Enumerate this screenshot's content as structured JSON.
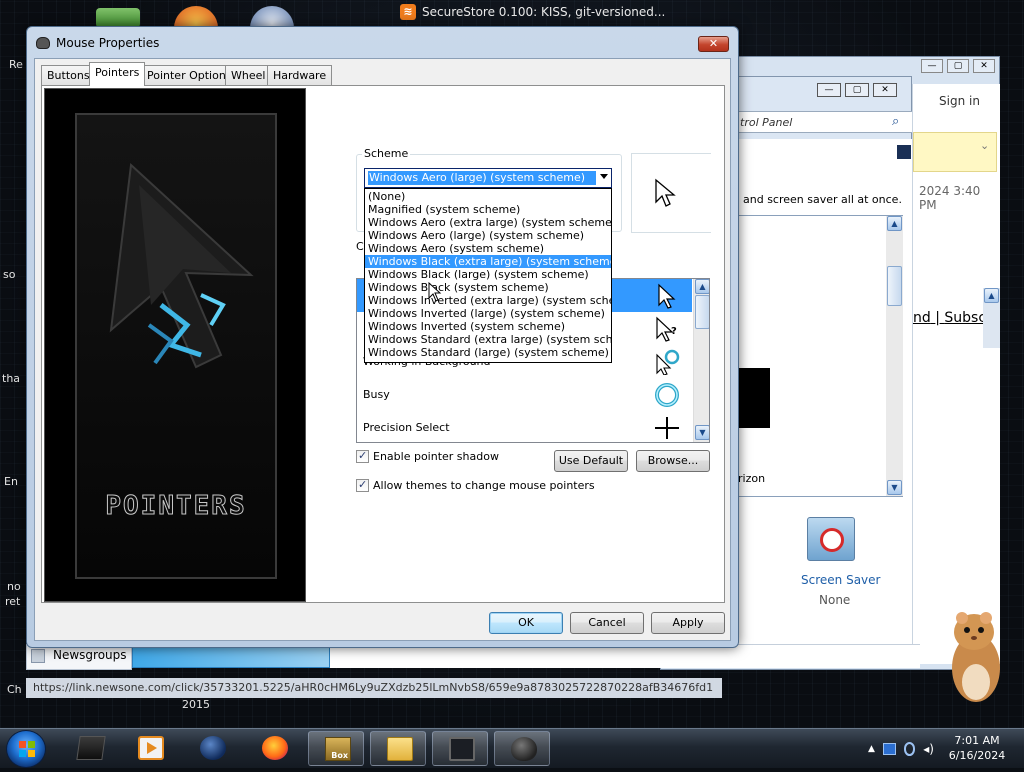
{
  "feed": {
    "icon": "rss-icon",
    "text": "SecureStore 0.100: KISS, git-versioned..."
  },
  "desktop_fragments": [
    "Re",
    "so",
    "tha",
    "En",
    "no",
    "ret",
    "Ch",
    "2015"
  ],
  "dialog": {
    "title": "Mouse Properties",
    "close_label": "✕",
    "tabs": [
      {
        "label": "Buttons",
        "active": false
      },
      {
        "label": "Pointers",
        "active": true
      },
      {
        "label": "Pointer Options",
        "active": false
      },
      {
        "label": "Wheel",
        "active": false
      },
      {
        "label": "Hardware",
        "active": false
      }
    ],
    "banner_text": "POINTERS",
    "scheme": {
      "group_label": "Scheme",
      "selected_value": "Windows Aero (large) (system scheme)",
      "options": [
        "(None)",
        "Magnified (system scheme)",
        "Windows Aero (extra large) (system scheme)",
        "Windows Aero (large) (system scheme)",
        "Windows Aero (system scheme)",
        "Windows Black (extra large) (system scheme)",
        "Windows Black (large) (system scheme)",
        "Windows Black (system scheme)",
        "Windows Inverted (extra large) (system scheme)",
        "Windows Inverted (large) (system scheme)",
        "Windows Inverted (system scheme)",
        "Windows Standard (extra large) (system scheme)",
        "Windows Standard (large) (system scheme)"
      ],
      "highlighted_option": "Windows Black (extra large) (system scheme)"
    },
    "customize": {
      "label": "Cu",
      "rows": [
        {
          "label": "",
          "cursor": "arrow-cursor-icon",
          "selected": true
        },
        {
          "label": "",
          "cursor": "help-cursor-icon",
          "selected": false
        },
        {
          "label": "Working in Background",
          "cursor": "working-cursor-icon",
          "selected": false
        },
        {
          "label": "Busy",
          "cursor": "busy-cursor-icon",
          "selected": false
        },
        {
          "label": "Precision Select",
          "cursor": "crosshair-cursor-icon",
          "selected": false
        }
      ]
    },
    "enable_shadow": {
      "label": "Enable pointer shadow",
      "checked": true
    },
    "allow_themes": {
      "label": "Allow themes to change mouse pointers",
      "checked": true
    },
    "use_default_label": "Use Default",
    "browse_label": "Browse...",
    "ok_label": "OK",
    "cancel_label": "Cancel",
    "apply_label": "Apply"
  },
  "background_window": {
    "sign_in": "Sign in",
    "address_fragment": "trol Panel",
    "timestamp_fragment": "2024 3:40 PM",
    "text_fragment": "and screen saver all at once.",
    "link_fragment_1": "nd",
    "link_fragment_2": "Subsc",
    "link_separator": "|",
    "horizon_fragment": "rizon",
    "screen_saver_label": "Screen Saver",
    "screen_saver_value": "None"
  },
  "newsgroups_tab": "Newsgroups",
  "status_url": "https://link.newsone.com/click/35733201.5225/aHR0cHM6Ly9uZXdzb25lLmNvbS8/659e9a8783025722870228afB34676fd1",
  "taskbar": {
    "items": [
      {
        "icon": "dark-app-icon",
        "open": false
      },
      {
        "icon": "media-player-icon",
        "open": false
      },
      {
        "icon": "globe-icon",
        "open": false
      },
      {
        "icon": "firefox-icon",
        "open": false
      },
      {
        "icon": "box-game-icon",
        "open": true,
        "label": "Box"
      },
      {
        "icon": "explorer-icon",
        "open": true
      },
      {
        "icon": "monitor-icon",
        "open": true
      },
      {
        "icon": "mouse-icon",
        "open": true
      }
    ],
    "clock_time": "7:01 AM",
    "clock_date": "6/16/2024"
  },
  "colors": {
    "selection": "#3399ff",
    "dialog_frame": "#c9d8ea",
    "taskbar": "#1f2731"
  }
}
